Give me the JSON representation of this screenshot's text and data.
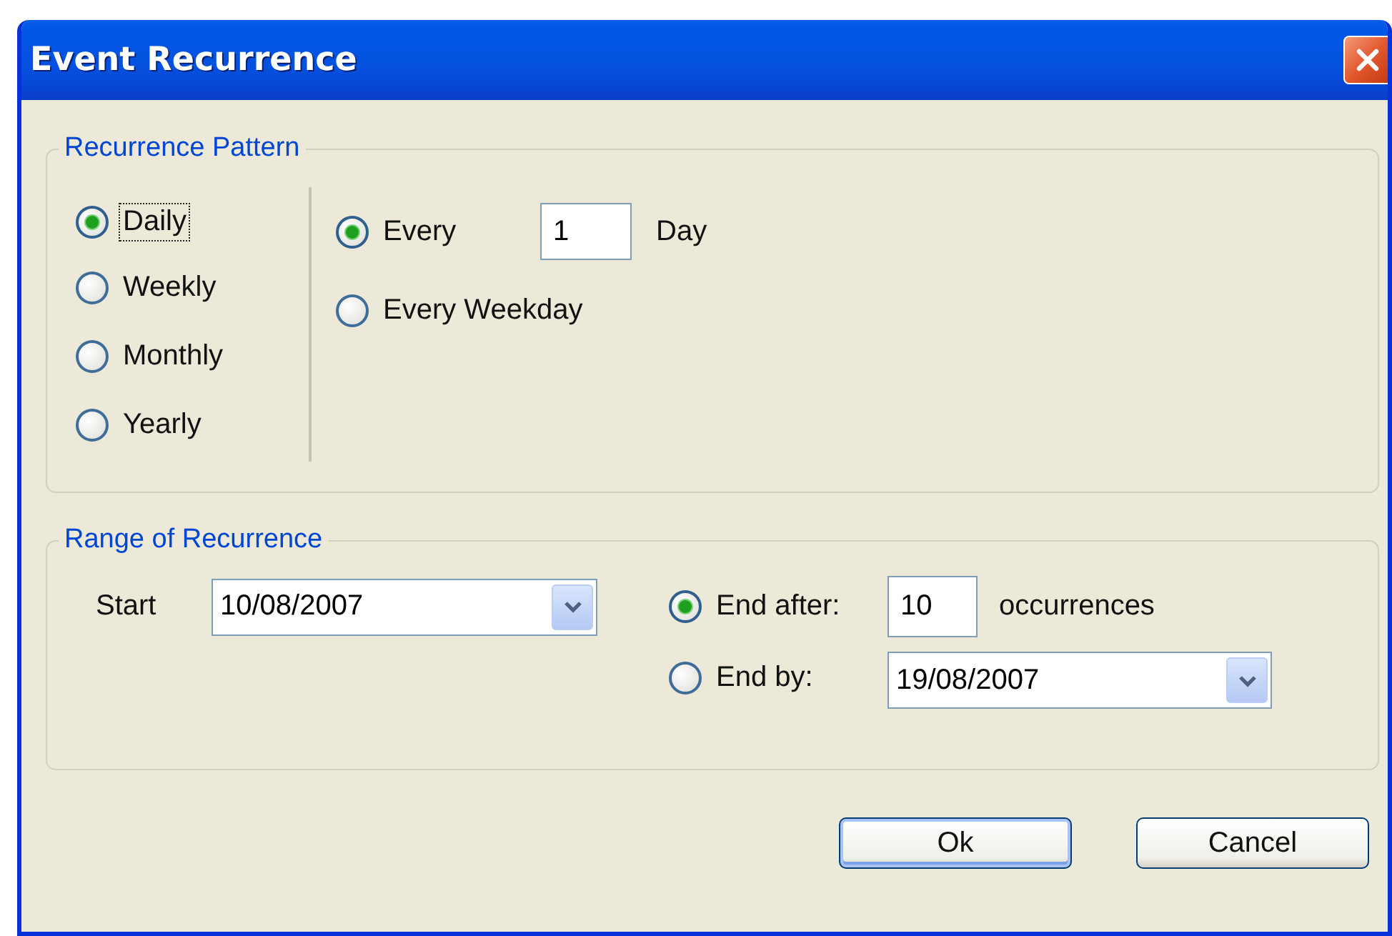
{
  "window": {
    "title": "Event Recurrence"
  },
  "recurrence_pattern": {
    "title": "Recurrence Pattern",
    "frequencies": [
      {
        "label": "Daily",
        "selected": true,
        "focused": true
      },
      {
        "label": "Weekly",
        "selected": false,
        "focused": false
      },
      {
        "label": "Monthly",
        "selected": false,
        "focused": false
      },
      {
        "label": "Yearly",
        "selected": false,
        "focused": false
      }
    ],
    "daily_options": [
      {
        "kind": "interval",
        "label": "Every",
        "selected": true,
        "value": "1",
        "unit": "Day"
      },
      {
        "kind": "plain",
        "label": "Every Weekday",
        "selected": false
      }
    ]
  },
  "range": {
    "title": "Range of Recurrence",
    "start_label": "Start",
    "start_date": "10/08/2007",
    "end_options": [
      {
        "kind": "count",
        "label": "End after:",
        "selected": true,
        "value": "10",
        "unit": "occurrences"
      },
      {
        "kind": "date",
        "label": "End by:",
        "selected": false,
        "value": "19/08/2007"
      }
    ]
  },
  "buttons": [
    {
      "label": "Ok",
      "default": true
    },
    {
      "label": "Cancel",
      "default": false
    }
  ]
}
